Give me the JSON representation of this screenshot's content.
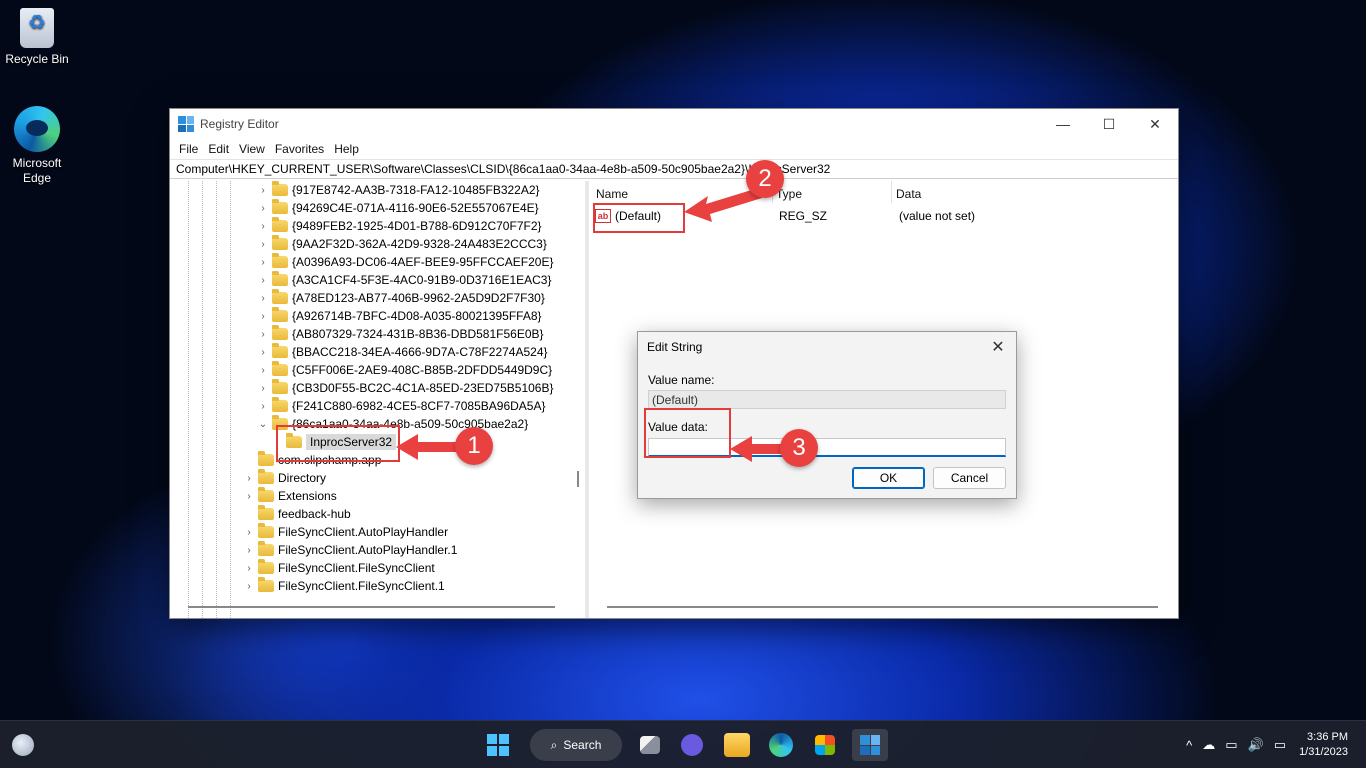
{
  "desktop": {
    "icons": [
      {
        "label": "Recycle Bin",
        "icon": "recycle-bin-icon"
      },
      {
        "label": "Microsoft Edge",
        "icon": "edge-icon"
      }
    ]
  },
  "window": {
    "title": "Registry Editor",
    "controls": {
      "minimize": "—",
      "maximize": "☐",
      "close": "✕"
    },
    "menu": [
      "File",
      "Edit",
      "View",
      "Favorites",
      "Help"
    ],
    "address": "Computer\\HKEY_CURRENT_USER\\Software\\Classes\\CLSID\\{86ca1aa0-34aa-4e8b-a509-50c905bae2a2}\\InprocServer32",
    "tree": [
      {
        "label": "{917E8742-AA3B-7318-FA12-10485FB322A2}",
        "chevron": "›"
      },
      {
        "label": "{94269C4E-071A-4116-90E6-52E557067E4E}",
        "chevron": "›"
      },
      {
        "label": "{9489FEB2-1925-4D01-B788-6D912C70F7F2}",
        "chevron": "›"
      },
      {
        "label": "{9AA2F32D-362A-42D9-9328-24A483E2CCC3}",
        "chevron": "›"
      },
      {
        "label": "{A0396A93-DC06-4AEF-BEE9-95FFCCAEF20E}",
        "chevron": "›"
      },
      {
        "label": "{A3CA1CF4-5F3E-4AC0-91B9-0D3716E1EAC3}",
        "chevron": "›"
      },
      {
        "label": "{A78ED123-AB77-406B-9962-2A5D9D2F7F30}",
        "chevron": "›"
      },
      {
        "label": "{A926714B-7BFC-4D08-A035-80021395FFA8}",
        "chevron": "›"
      },
      {
        "label": "{AB807329-7324-431B-8B36-DBD581F56E0B}",
        "chevron": "›"
      },
      {
        "label": "{BBACC218-34EA-4666-9D7A-C78F2274A524}",
        "chevron": "›"
      },
      {
        "label": "{C5FF006E-2AE9-408C-B85B-2DFDD5449D9C}",
        "chevron": "›"
      },
      {
        "label": "{CB3D0F55-BC2C-4C1A-85ED-23ED75B5106B}",
        "chevron": "›"
      },
      {
        "label": "{F241C880-6982-4CE5-8CF7-7085BA96DA5A}",
        "chevron": "›"
      },
      {
        "label": "{86ca1aa0-34aa-4e8b-a509-50c905bae2a2}",
        "chevron": "⌄"
      },
      {
        "label": "InprocServer32",
        "chevron": ""
      },
      {
        "label": "com.clipchamp.app",
        "chevron": ""
      },
      {
        "label": "Directory",
        "chevron": "›"
      },
      {
        "label": "Extensions",
        "chevron": "›"
      },
      {
        "label": "feedback-hub",
        "chevron": ""
      },
      {
        "label": "FileSyncClient.AutoPlayHandler",
        "chevron": "›"
      },
      {
        "label": "FileSyncClient.AutoPlayHandler.1",
        "chevron": "›"
      },
      {
        "label": "FileSyncClient.FileSyncClient",
        "chevron": "›"
      },
      {
        "label": "FileSyncClient.FileSyncClient.1",
        "chevron": "›"
      }
    ],
    "columns": {
      "name": "Name",
      "type": "Type",
      "data": "Data"
    },
    "values": [
      {
        "name": "(Default)",
        "type": "REG_SZ",
        "data": "(value not set)",
        "icon": "ab"
      }
    ]
  },
  "dialog": {
    "title": "Edit String",
    "close": "✕",
    "value_name_label": "Value name:",
    "value_name": "(Default)",
    "value_data_label": "Value data:",
    "value_data": "",
    "ok": "OK",
    "cancel": "Cancel"
  },
  "annotations": {
    "step1": "1",
    "step2": "2",
    "step3": "3",
    "color": "#e8413f"
  },
  "taskbar": {
    "search": "Search",
    "time": "3:36 PM",
    "date": "1/31/2023",
    "tray": {
      "chevron": "^",
      "cloud": "☁",
      "volume": "🔊"
    }
  }
}
